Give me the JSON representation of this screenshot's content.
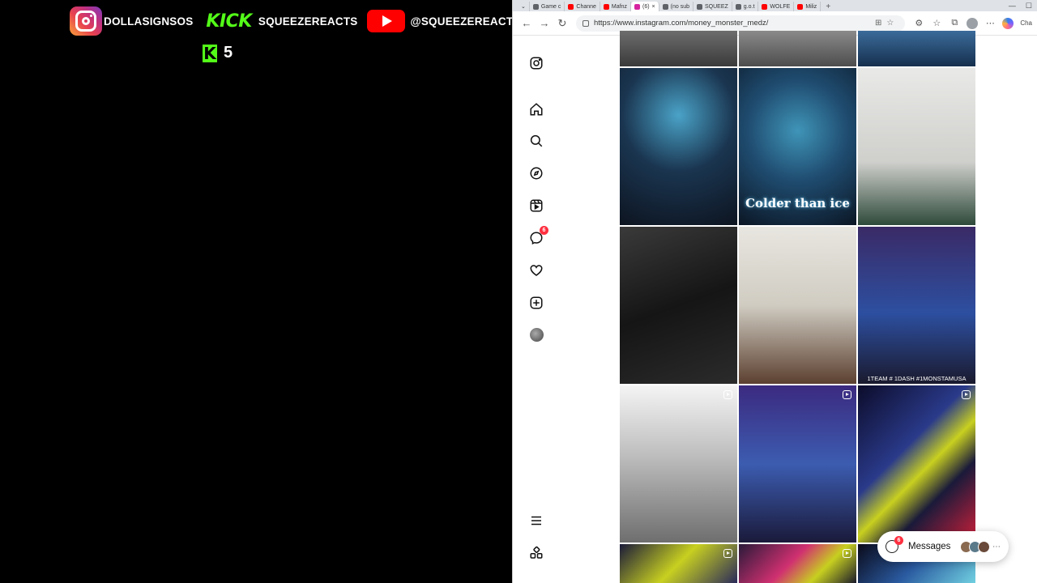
{
  "overlay": {
    "instagram_handle": "DOLLASIGNSOS",
    "kick_word": "KICK",
    "kick_handle": "SQUEEZEREACTS",
    "youtube_handle": "@SQUEEZEREACTS",
    "kick_badge": "K",
    "kick_viewers": "5"
  },
  "browser": {
    "tabs": [
      {
        "label": "Game c",
        "color": "#5f6368"
      },
      {
        "label": "Channe",
        "color": "#ff0000"
      },
      {
        "label": "Mafnz",
        "color": "#ff0000"
      },
      {
        "label": "(6)",
        "color": "#d6249f",
        "active": true
      },
      {
        "label": "(no sub",
        "color": "#5f6368"
      },
      {
        "label": "SQUEEZ",
        "color": "#5f6368"
      },
      {
        "label": "g.o.t",
        "color": "#5f6368"
      },
      {
        "label": "WOLFE",
        "color": "#ff0000"
      },
      {
        "label": "Miliz",
        "color": "#ff0000"
      }
    ],
    "url": "https://www.instagram.com/money_monster_medz/",
    "toolbar_label": "Cha"
  },
  "instagram": {
    "notification_count": "6",
    "messages_label": "Messages",
    "messages_count": "6",
    "posts": [
      {
        "caption": "Colder than ice"
      },
      {
        "caption": "1TEAM # 1DASH #1MONSTAMUSA"
      }
    ]
  }
}
